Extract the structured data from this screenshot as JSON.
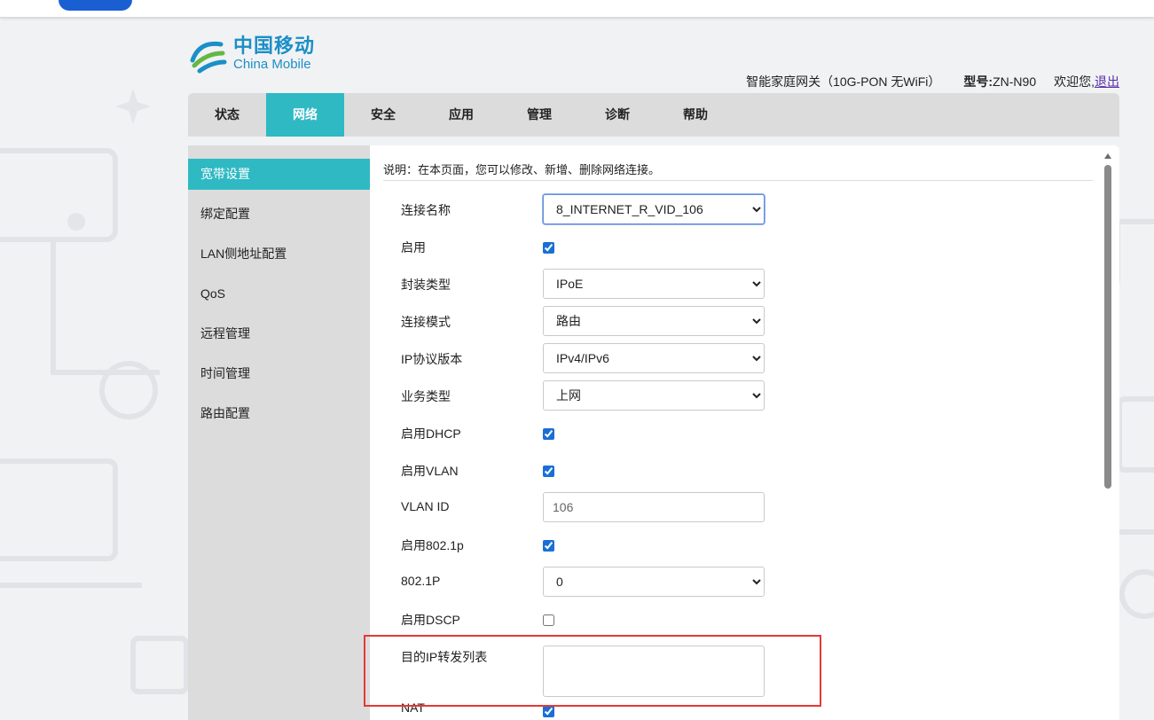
{
  "logo": {
    "cn": "中国移动",
    "en": "China Mobile"
  },
  "header": {
    "device": "智能家庭网关（10G-PON 无WiFi）",
    "model_label": "型号:",
    "model_value": "ZN-N90",
    "welcome": "欢迎您,",
    "logout": "退出"
  },
  "nav": {
    "items": [
      "状态",
      "网络",
      "安全",
      "应用",
      "管理",
      "诊断",
      "帮助"
    ],
    "active_index": 1
  },
  "sidebar": {
    "items": [
      "宽带设置",
      "绑定配置",
      "LAN侧地址配置",
      "QoS",
      "远程管理",
      "时间管理",
      "路由配置"
    ],
    "active_index": 0
  },
  "content": {
    "description": "说明：在本页面，您可以修改、新增、删除网络连接。",
    "fields": {
      "connection_name": {
        "label": "连接名称",
        "value": "8_INTERNET_R_VID_106"
      },
      "enable": {
        "label": "启用",
        "checked": true
      },
      "encap_type": {
        "label": "封装类型",
        "value": "IPoE"
      },
      "conn_mode": {
        "label": "连接模式",
        "value": "路由"
      },
      "ip_version": {
        "label": "IP协议版本",
        "value": "IPv4/IPv6"
      },
      "service_type": {
        "label": "业务类型",
        "value": "上网"
      },
      "enable_dhcp": {
        "label": "启用DHCP",
        "checked": true
      },
      "enable_vlan": {
        "label": "启用VLAN",
        "checked": true
      },
      "vlan_id": {
        "label": "VLAN ID",
        "value": "106"
      },
      "enable_8021p": {
        "label": "启用802.1p",
        "checked": true
      },
      "p8021": {
        "label": "802.1P",
        "value": "0"
      },
      "enable_dscp": {
        "label": "启用DSCP",
        "checked": false
      },
      "dest_ip_list": {
        "label": "目的IP转发列表",
        "value": ""
      },
      "nat": {
        "label": "NAT",
        "checked": true
      }
    }
  },
  "colors": {
    "accent": "#2fb9c3",
    "nav_bg": "#dcdcdc",
    "highlight": "#e53935",
    "logo": "#1b8fc7"
  }
}
